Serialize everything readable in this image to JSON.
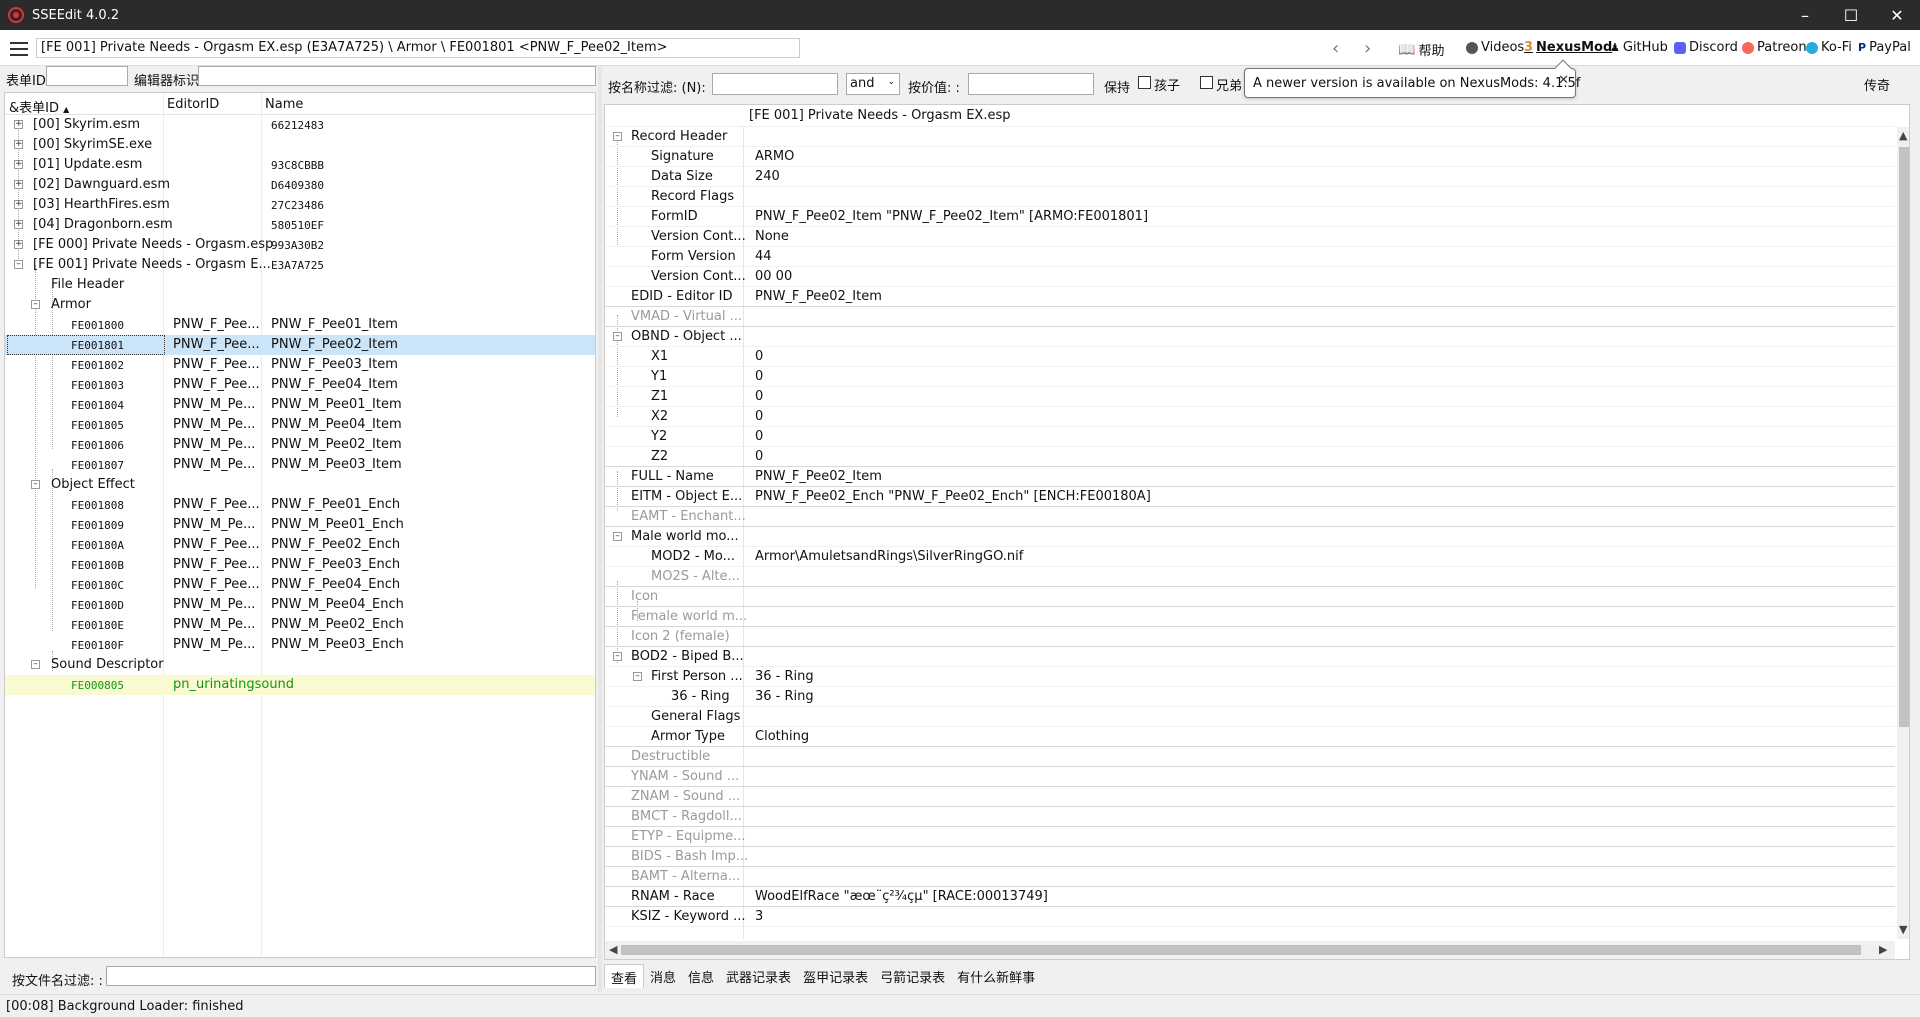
{
  "window": {
    "title": "SSEEdit 4.0.2"
  },
  "pathbar": {
    "path": "[FE 001] Private Needs - Orgasm EX.esp (E3A7A725) \\ Armor \\ FE001801 <PNW_F_Pee02_Item>",
    "links": [
      "帮助",
      "Videos",
      "NexusMod",
      "GitHub",
      "Discord",
      "Patreon",
      "Ko-Fi",
      "PayPal"
    ]
  },
  "left_filter": {
    "formid_label": "表单ID",
    "editorid_label": "编辑器标识",
    "file_filter_label": "按文件名过滤: :"
  },
  "tree": {
    "headers": [
      "&表单ID",
      "EditorID",
      "Name"
    ],
    "rows": [
      {
        "c1": "[00] Skyrim.esm",
        "c3": "66212483"
      },
      {
        "c1": "[00] SkyrimSE.exe",
        "c3": ""
      },
      {
        "c1": "[01] Update.esm",
        "c3": "93C8CBBB"
      },
      {
        "c1": "[02] Dawnguard.esm",
        "c3": "D6409380"
      },
      {
        "c1": "[03] HearthFires.esm",
        "c3": "27C23486"
      },
      {
        "c1": "[04] Dragonborn.esm",
        "c3": "580510EF"
      },
      {
        "c1": "[FE 000] Private Needs - Orgasm.esp",
        "c3": "993A30B2"
      },
      {
        "c1": "[FE 001] Private Needs - Orgasm E...",
        "c3": "E3A7A725"
      },
      {
        "c1": "File Header"
      },
      {
        "c1": "Armor"
      },
      {
        "c1": "FE001800",
        "c2": "PNW_F_Pee...",
        "c3": "PNW_F_Pee01_Item"
      },
      {
        "c1": "FE001801",
        "c2": "PNW_F_Pee...",
        "c3": "PNW_F_Pee02_Item"
      },
      {
        "c1": "FE001802",
        "c2": "PNW_F_Pee...",
        "c3": "PNW_F_Pee03_Item"
      },
      {
        "c1": "FE001803",
        "c2": "PNW_F_Pee...",
        "c3": "PNW_F_Pee04_Item"
      },
      {
        "c1": "FE001804",
        "c2": "PNW_M_Pe...",
        "c3": "PNW_M_Pee01_Item"
      },
      {
        "c1": "FE001805",
        "c2": "PNW_M_Pe...",
        "c3": "PNW_M_Pee04_Item"
      },
      {
        "c1": "FE001806",
        "c2": "PNW_M_Pe...",
        "c3": "PNW_M_Pee02_Item"
      },
      {
        "c1": "FE001807",
        "c2": "PNW_M_Pe...",
        "c3": "PNW_M_Pee03_Item"
      },
      {
        "c1": "Object Effect"
      },
      {
        "c1": "FE001808",
        "c2": "PNW_F_Pee...",
        "c3": "PNW_F_Pee01_Ench"
      },
      {
        "c1": "FE001809",
        "c2": "PNW_M_Pe...",
        "c3": "PNW_M_Pee01_Ench"
      },
      {
        "c1": "FE00180A",
        "c2": "PNW_F_Pee...",
        "c3": "PNW_F_Pee02_Ench"
      },
      {
        "c1": "FE00180B",
        "c2": "PNW_F_Pee...",
        "c3": "PNW_F_Pee03_Ench"
      },
      {
        "c1": "FE00180C",
        "c2": "PNW_F_Pee...",
        "c3": "PNW_F_Pee04_Ench"
      },
      {
        "c1": "FE00180D",
        "c2": "PNW_M_Pe...",
        "c3": "PNW_M_Pee04_Ench"
      },
      {
        "c1": "FE00180E",
        "c2": "PNW_M_Pe...",
        "c3": "PNW_M_Pee02_Ench"
      },
      {
        "c1": "FE00180F",
        "c2": "PNW_M_Pe...",
        "c3": "PNW_M_Pee03_Ench"
      },
      {
        "c1": "Sound Descriptor"
      },
      {
        "c1": "FE000805",
        "c2": "pn_urinatingsound",
        "c3": ""
      }
    ]
  },
  "right_filter": {
    "name_filter_label": "按名称过滤: (N):",
    "and_value": "and",
    "value_filter_label": "按价值: :",
    "keep_label": "保持",
    "children_label": "孩子",
    "siblings_label": "兄弟",
    "legend_label": "传奇"
  },
  "tooltip": {
    "text": "A newer version is available on NexusMods: 4.1.5f"
  },
  "record": {
    "file_header": "[FE 001] Private Needs - Orgasm EX.esp",
    "rows": [
      {
        "k": "Record Header",
        "v": ""
      },
      {
        "k": "Signature",
        "v": "ARMO"
      },
      {
        "k": "Data Size",
        "v": "240"
      },
      {
        "k": "Record Flags",
        "v": ""
      },
      {
        "k": "FormID",
        "v": "PNW_F_Pee02_Item \"PNW_F_Pee02_Item\" [ARMO:FE001801]"
      },
      {
        "k": "Version Cont...",
        "v": "None"
      },
      {
        "k": "Form Version",
        "v": "44"
      },
      {
        "k": "Version Cont...",
        "v": "00 00"
      },
      {
        "k": "EDID - Editor ID",
        "v": "PNW_F_Pee02_Item"
      },
      {
        "k": "VMAD - Virtual ...",
        "v": ""
      },
      {
        "k": "OBND - Object ...",
        "v": ""
      },
      {
        "k": "X1",
        "v": "0"
      },
      {
        "k": "Y1",
        "v": "0"
      },
      {
        "k": "Z1",
        "v": "0"
      },
      {
        "k": "X2",
        "v": "0"
      },
      {
        "k": "Y2",
        "v": "0"
      },
      {
        "k": "Z2",
        "v": "0"
      },
      {
        "k": "FULL - Name",
        "v": "PNW_F_Pee02_Item"
      },
      {
        "k": "EITM - Object E...",
        "v": "PNW_F_Pee02_Ench \"PNW_F_Pee02_Ench\" [ENCH:FE00180A]"
      },
      {
        "k": "EAMT - Enchant...",
        "v": ""
      },
      {
        "k": "Male world mo...",
        "v": ""
      },
      {
        "k": "MOD2 - Mo...",
        "v": "Armor\\AmuletsandRings\\SilverRingGO.nif"
      },
      {
        "k": "MO2S - Alte...",
        "v": ""
      },
      {
        "k": "Icon",
        "v": ""
      },
      {
        "k": "Female world m...",
        "v": ""
      },
      {
        "k": "Icon 2 (female)",
        "v": ""
      },
      {
        "k": "BOD2 - Biped B...",
        "v": ""
      },
      {
        "k": "First Person ...",
        "v": "36 - Ring"
      },
      {
        "k": "36 - Ring",
        "v": "36 - Ring"
      },
      {
        "k": "General Flags",
        "v": ""
      },
      {
        "k": "Armor Type",
        "v": "Clothing"
      },
      {
        "k": "Destructible",
        "v": ""
      },
      {
        "k": "YNAM - Sound ...",
        "v": ""
      },
      {
        "k": "ZNAM - Sound ...",
        "v": ""
      },
      {
        "k": "BMCT - Ragdoll...",
        "v": ""
      },
      {
        "k": "ETYP - Equipme...",
        "v": ""
      },
      {
        "k": "BIDS - Bash Imp...",
        "v": ""
      },
      {
        "k": "BAMT - Alterna...",
        "v": ""
      },
      {
        "k": "RNAM - Race",
        "v": "WoodElfRace \"æœ¨ç²¾çµ\" [RACE:00013749]"
      },
      {
        "k": "KSIZ - Keyword ...",
        "v": "3"
      }
    ]
  },
  "tabs": [
    "查看",
    "消息",
    "信息",
    "武器记录表",
    "盔甲记录表",
    "弓箭记录表",
    "有什么新鲜事"
  ],
  "status": {
    "text": "[00:08] Background Loader: finished"
  }
}
